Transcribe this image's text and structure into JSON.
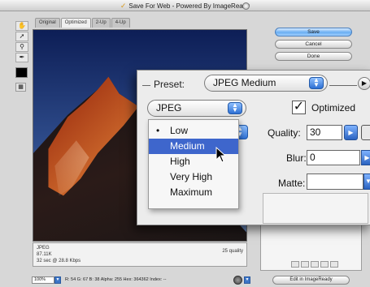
{
  "window": {
    "title": "Save For Web - Powered By ImageReady",
    "app_icon": "save-for-web-icon"
  },
  "tabs": [
    {
      "label": "Original",
      "active": false
    },
    {
      "label": "Optimized",
      "active": true
    },
    {
      "label": "2-Up",
      "active": false
    },
    {
      "label": "4-Up",
      "active": false
    }
  ],
  "toolbox": {
    "tools": [
      "hand-tool-icon",
      "slice-select-tool-icon",
      "zoom-tool-icon",
      "eyedropper-tool-icon"
    ]
  },
  "buttons": {
    "save": "Save",
    "cancel": "Cancel",
    "done": "Done",
    "edit_imageready": "Edit in ImageReady"
  },
  "preview_info": {
    "format": "JPEG",
    "size": "87.11K",
    "time": "32 sec @ 28.8 Kbps",
    "quality": "25 quality"
  },
  "statusbar": {
    "zoom": "100%",
    "readout": "R: 54  G: 67  B: 38  Alpha: 255  Hex: 364362  Index: --"
  },
  "settings": {
    "preset_label": "Preset:",
    "preset_value": "JPEG Medium",
    "format_value": "JPEG",
    "optimized_label": "Optimized",
    "optimized_checked": true,
    "quality_label": "Quality:",
    "quality_value": "30",
    "blur_label": "Blur:",
    "blur_value": "0",
    "matte_label": "Matte:",
    "matte_value": ""
  },
  "quality_menu": {
    "items": [
      "Low",
      "Medium",
      "High",
      "Very High",
      "Maximum"
    ],
    "checked": "Low",
    "highlighted": "Medium"
  },
  "colors": {
    "highlight": "#3e66cc",
    "default_button": "#6aaef2",
    "aqua_blue": "#2d6fd3"
  }
}
